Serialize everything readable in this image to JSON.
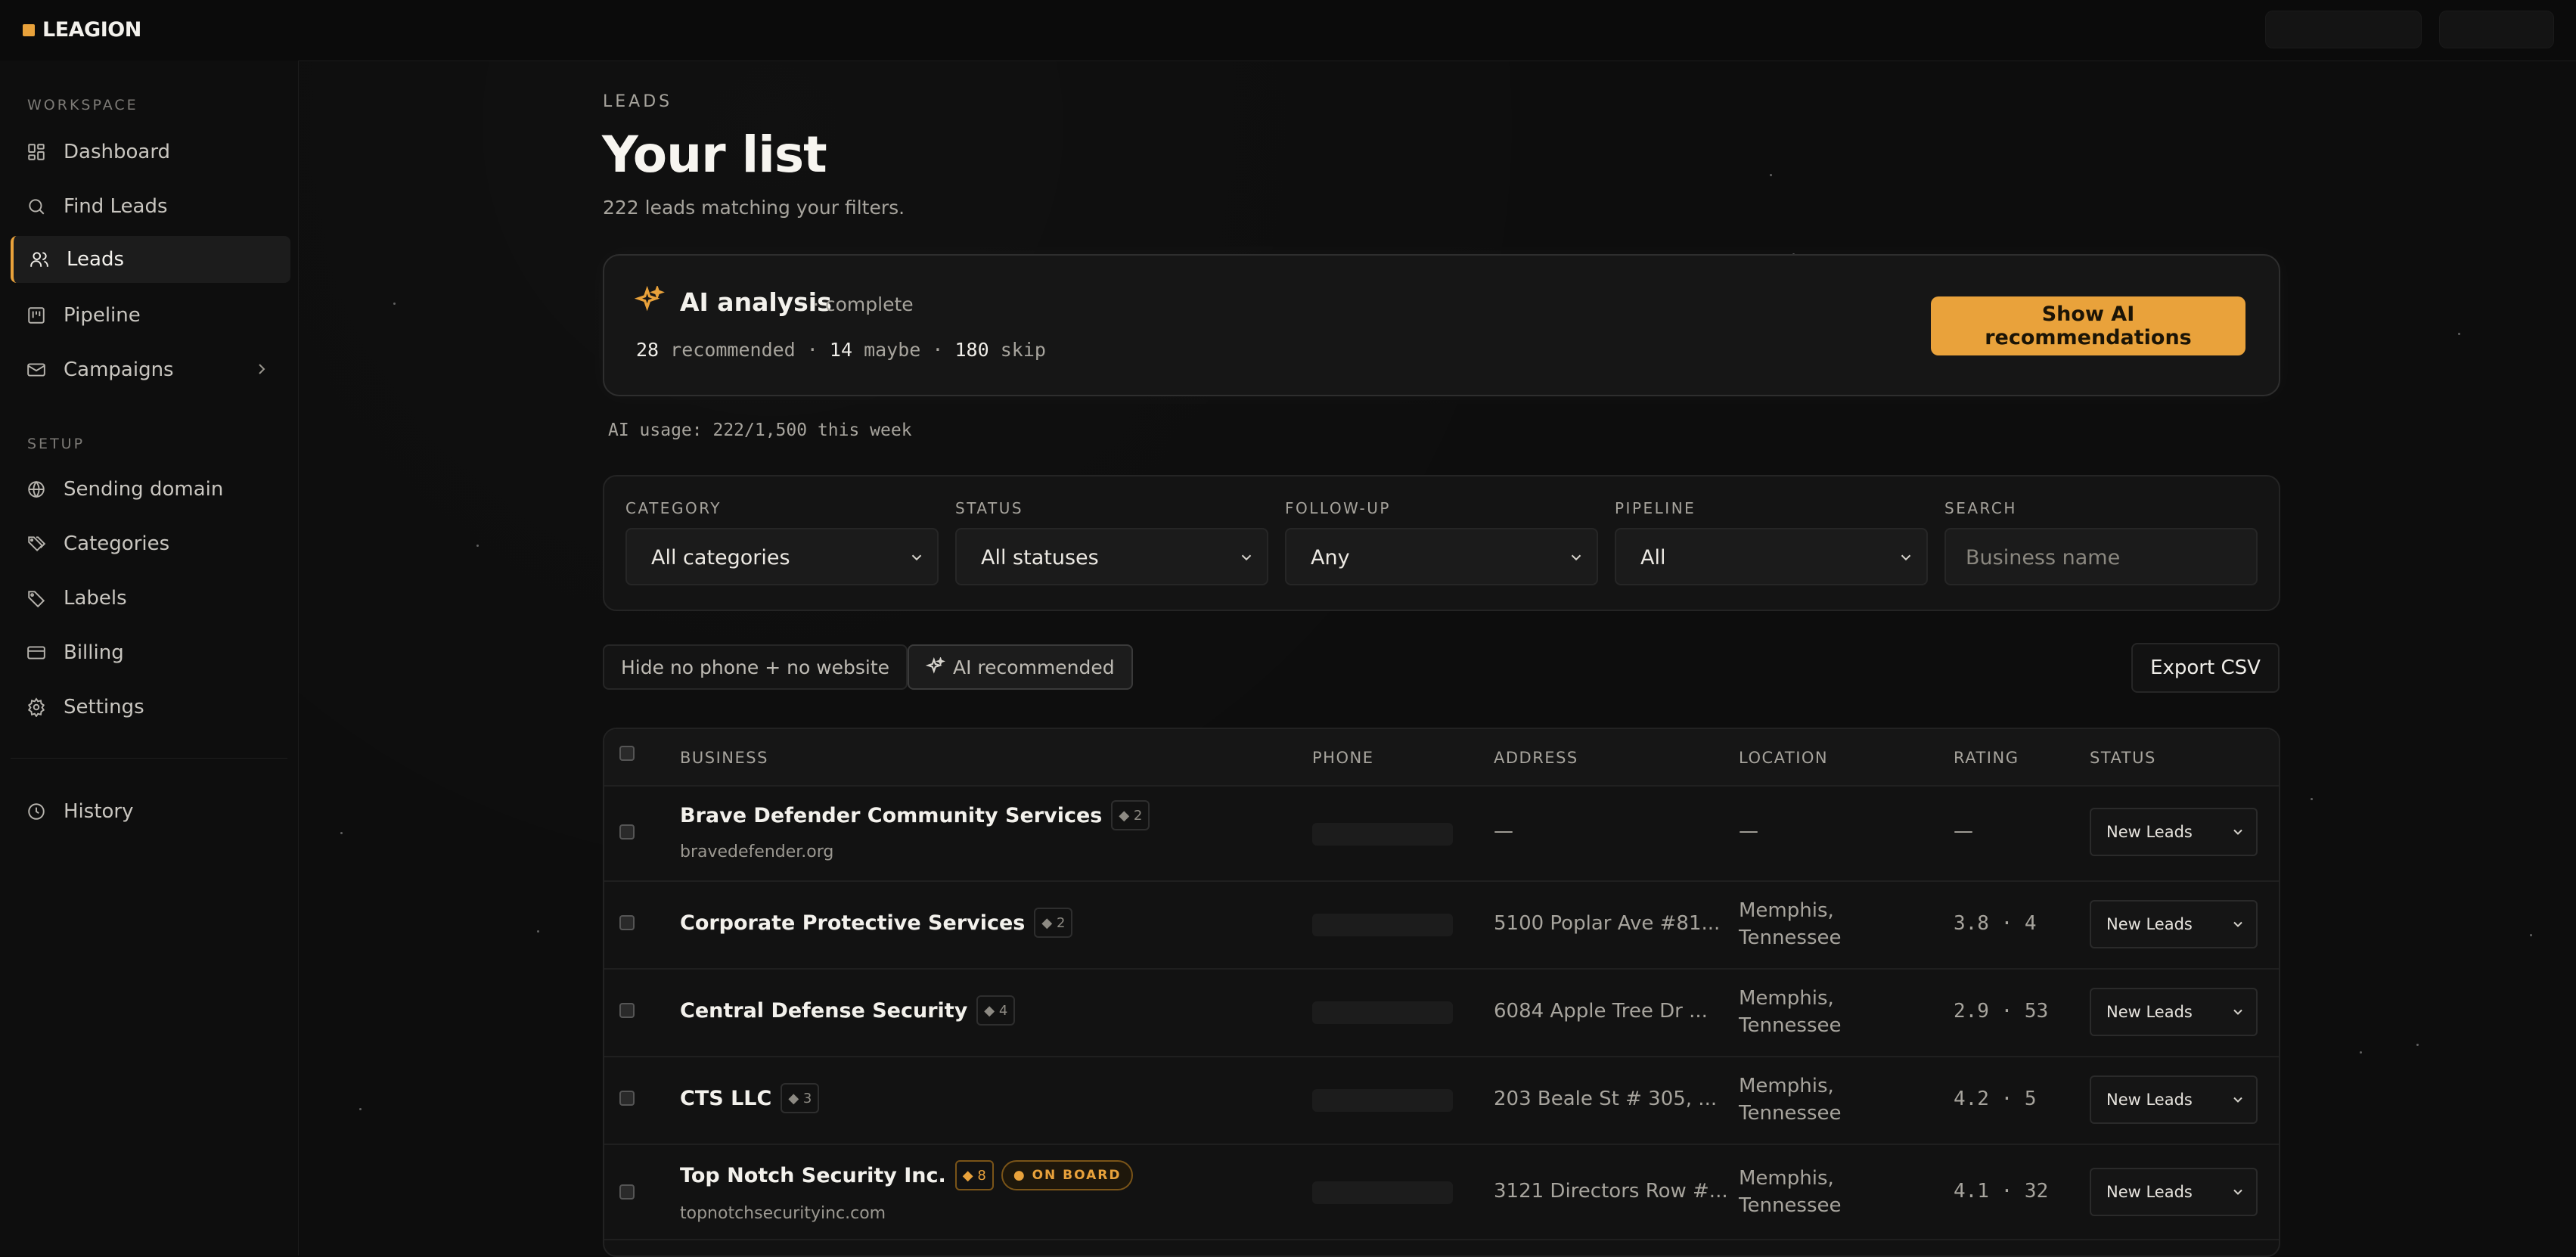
{
  "app": {
    "name": "LEAGION"
  },
  "sidebar": {
    "workspace_label": "WORKSPACE",
    "setup_label": "SETUP",
    "workspace_items": [
      {
        "label": "Dashboard",
        "icon": "grid-icon"
      },
      {
        "label": "Find Leads",
        "icon": "search-icon"
      },
      {
        "label": "Leads",
        "icon": "users-icon",
        "active": true
      },
      {
        "label": "Pipeline",
        "icon": "kanban-icon"
      },
      {
        "label": "Campaigns",
        "icon": "mail-icon",
        "has_submenu": true
      }
    ],
    "setup_items": [
      {
        "label": "Sending domain",
        "icon": "globe-icon"
      },
      {
        "label": "Categories",
        "icon": "tags-icon"
      },
      {
        "label": "Labels",
        "icon": "tag-icon"
      },
      {
        "label": "Billing",
        "icon": "credit-card-icon"
      },
      {
        "label": "Settings",
        "icon": "gear-icon"
      }
    ],
    "history_item": {
      "label": "History",
      "icon": "clock-icon"
    }
  },
  "page": {
    "eyebrow": "LEADS",
    "title": "Your list",
    "subtitle": "222 leads matching your filters."
  },
  "ai_card": {
    "title": "AI analysis",
    "status": "· complete",
    "recommended_count": "28",
    "recommended_label": "recommended",
    "maybe_count": "14",
    "maybe_label": "maybe",
    "skip_count": "180",
    "skip_label": "skip",
    "button_label": "Show AI recommendations",
    "usage": "AI usage: 222/1,500 this week"
  },
  "filters": {
    "category": {
      "label": "CATEGORY",
      "value": "All categories"
    },
    "status": {
      "label": "STATUS",
      "value": "All statuses"
    },
    "followup": {
      "label": "FOLLOW-UP",
      "value": "Any"
    },
    "pipeline": {
      "label": "PIPELINE",
      "value": "All"
    },
    "search": {
      "label": "SEARCH",
      "placeholder": "Business name"
    }
  },
  "toolbar": {
    "hide_chip": "Hide no phone + no website",
    "ai_chip": "AI recommended",
    "export_label": "Export CSV"
  },
  "table": {
    "columns": {
      "business": "BUSINESS",
      "phone": "PHONE",
      "address": "ADDRESS",
      "location": "LOCATION",
      "rating": "RATING",
      "status": "STATUS"
    },
    "rows": [
      {
        "name": "Brave Defender Community Services",
        "score": "◆ 2",
        "domain": "bravedefender.org",
        "address": "—",
        "location_city": "—",
        "location_state": "",
        "rating": "—",
        "status": "New Leads"
      },
      {
        "name": "Corporate Protective Services",
        "score": "◆ 2",
        "domain": "",
        "address": "5100 Poplar Ave #81...",
        "location_city": "Memphis,",
        "location_state": "Tennessee",
        "rating": "3.8 · 4",
        "status": "New Leads"
      },
      {
        "name": "Central Defense Security",
        "score": "◆ 4",
        "domain": "",
        "address": "6084 Apple Tree Dr ...",
        "location_city": "Memphis,",
        "location_state": "Tennessee",
        "rating": "2.9 · 53",
        "status": "New Leads"
      },
      {
        "name": "CTS LLC",
        "score": "◆ 3",
        "domain": "",
        "address": "203 Beale St # 305, ...",
        "location_city": "Memphis,",
        "location_state": "Tennessee",
        "rating": "4.2 · 5",
        "status": "New Leads"
      },
      {
        "name": "Top Notch Security Inc.",
        "score": "◆ 8",
        "badge": "● ON BOARD",
        "domain": "topnotchsecurityinc.com",
        "address": "3121 Directors Row #...",
        "location_city": "Memphis,",
        "location_state": "Tennessee",
        "rating": "4.1 · 32",
        "status": "New Leads"
      }
    ]
  },
  "colors": {
    "accent": "#e9a23b",
    "background": "#0c0c0c",
    "surface": "#161616"
  }
}
